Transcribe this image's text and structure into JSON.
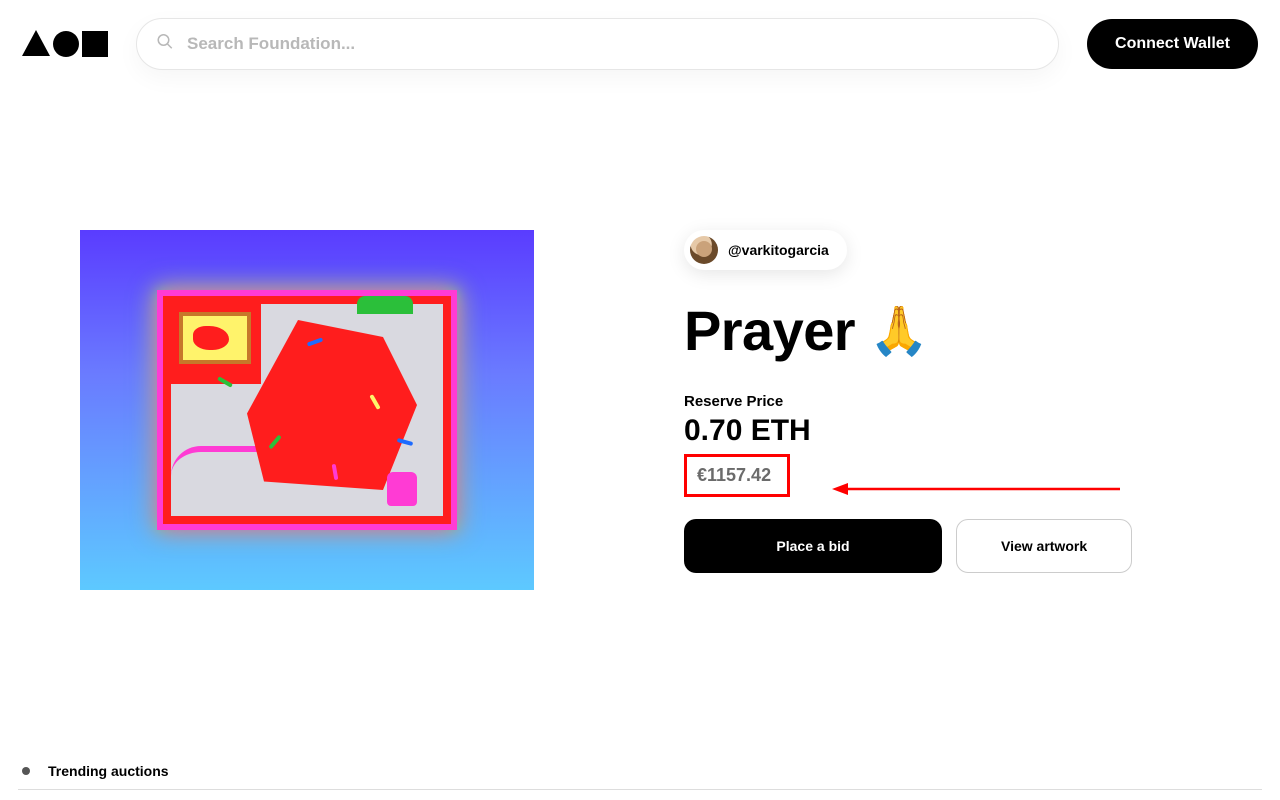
{
  "header": {
    "search_placeholder": "Search Foundation...",
    "connect_label": "Connect Wallet"
  },
  "artwork": {
    "creator_handle": "@varkitogarcia",
    "title": "Prayer",
    "title_emoji": "🙏",
    "reserve_label": "Reserve Price",
    "price_eth": "0.70 ETH",
    "price_fiat": "€1157.42",
    "place_bid_label": "Place a bid",
    "view_label": "View artwork"
  },
  "footer": {
    "trending_label": "Trending auctions"
  },
  "annotation": {
    "highlight_color": "#ff0000"
  }
}
